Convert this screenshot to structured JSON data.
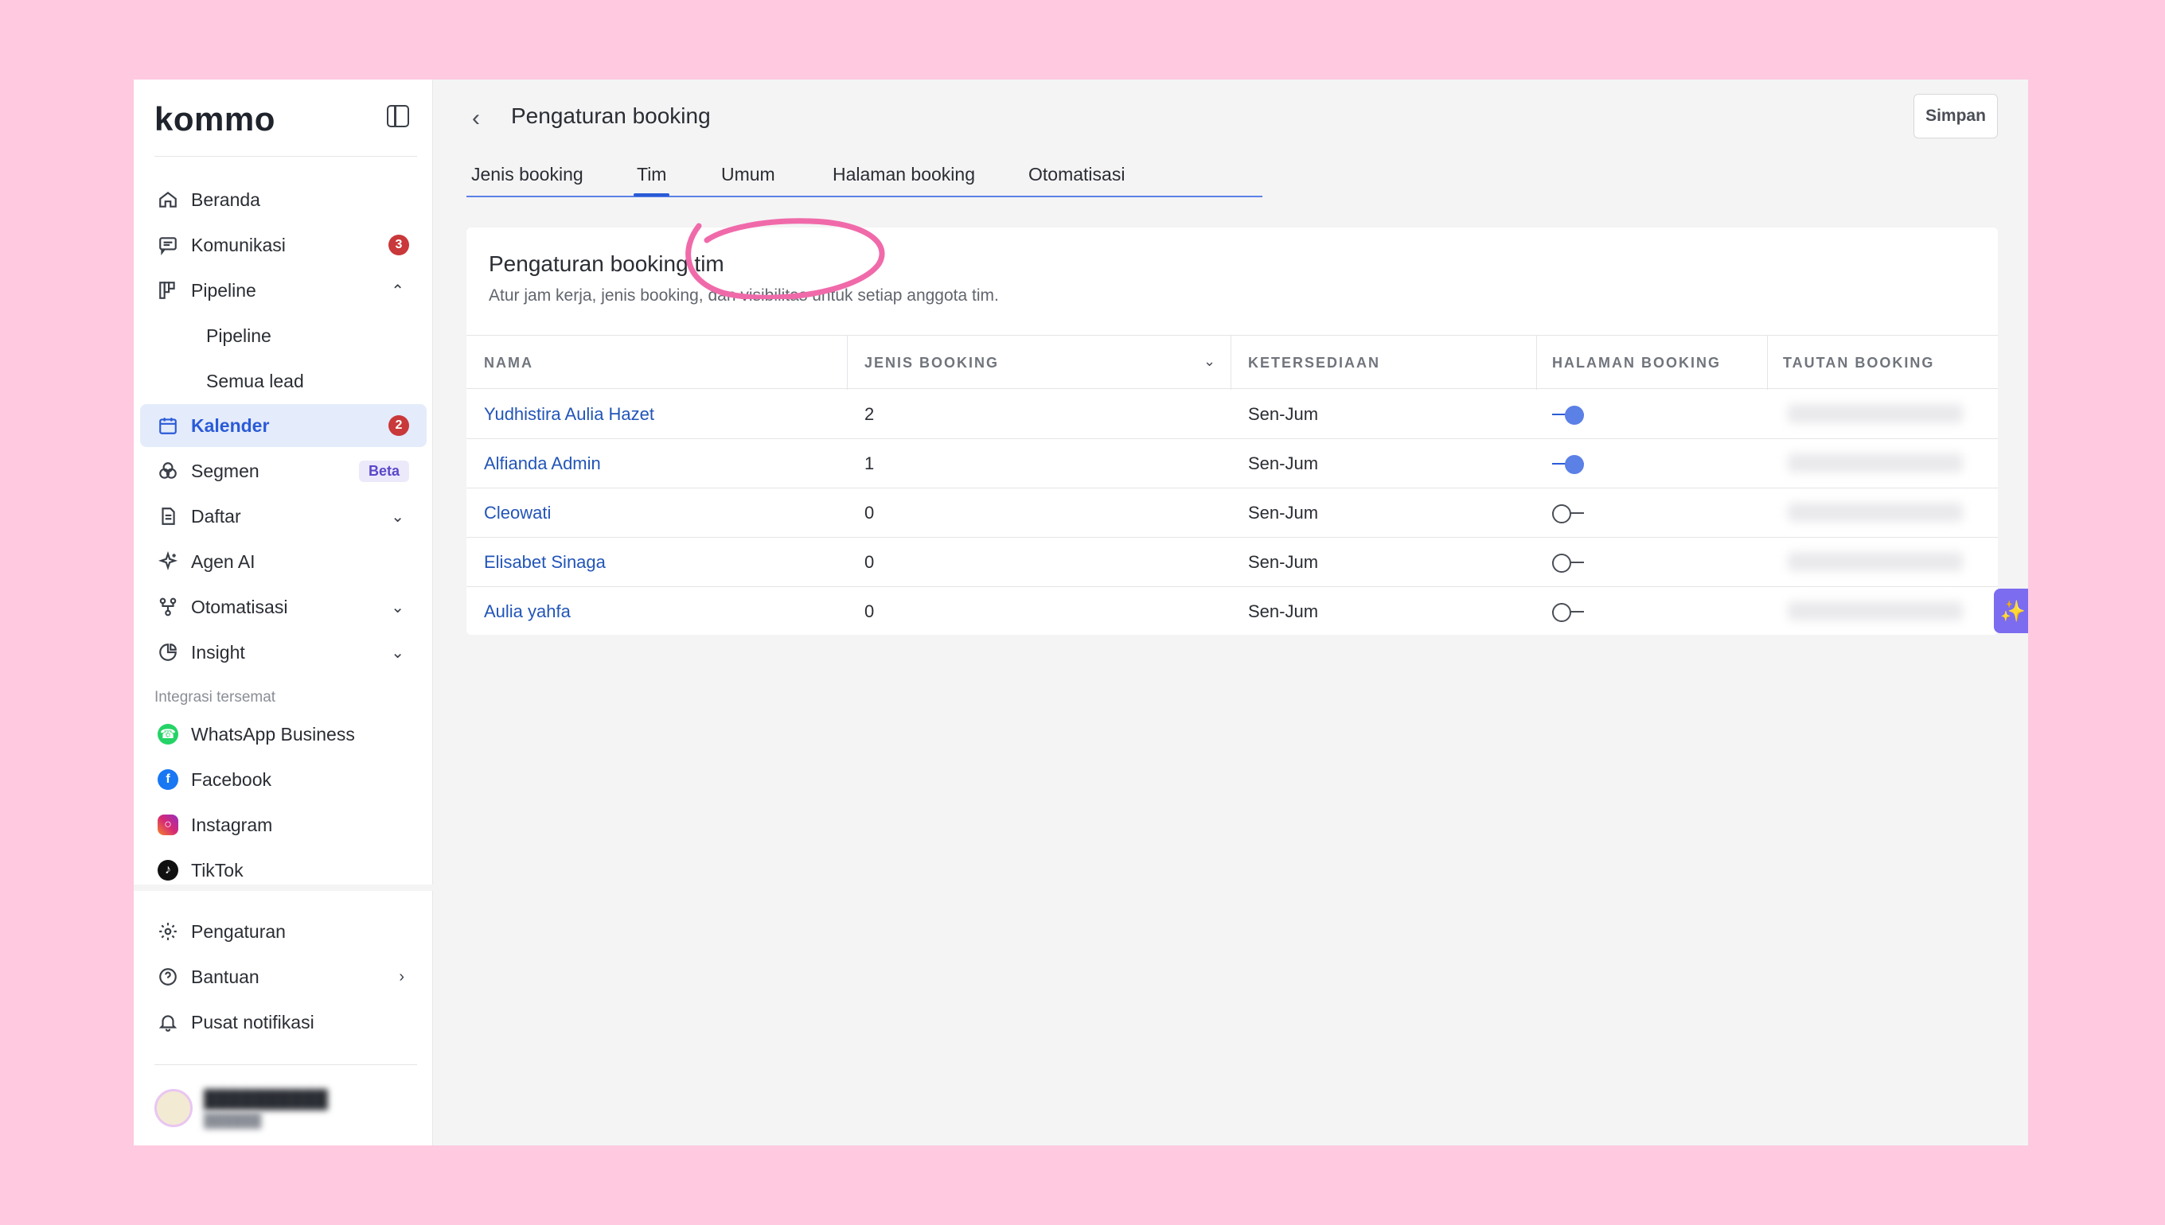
{
  "app": {
    "logo": "kommo"
  },
  "sidebar": {
    "items": [
      {
        "label": "Beranda",
        "icon": "home-icon"
      },
      {
        "label": "Komunikasi",
        "icon": "chat-icon",
        "badge": "3"
      },
      {
        "label": "Pipeline",
        "icon": "pipeline-icon",
        "expanded": true
      },
      {
        "label": "Pipeline"
      },
      {
        "label": "Semua lead"
      },
      {
        "label": "Kalender",
        "icon": "calendar-icon",
        "badge": "2",
        "active": true
      },
      {
        "label": "Segmen",
        "icon": "segment-icon",
        "tag": "Beta"
      },
      {
        "label": "Daftar",
        "icon": "list-icon"
      },
      {
        "label": "Agen AI",
        "icon": "sparkle-icon"
      },
      {
        "label": "Otomatisasi",
        "icon": "automation-icon"
      },
      {
        "label": "Insight",
        "icon": "chart-icon"
      }
    ],
    "integrations_label": "Integrasi tersemat",
    "integrations": [
      {
        "label": "WhatsApp Business",
        "color": "#25d366"
      },
      {
        "label": "Facebook",
        "color": "#1877f2"
      },
      {
        "label": "Instagram",
        "color": "#d62976"
      },
      {
        "label": "TikTok",
        "color": "#111111"
      }
    ],
    "bottom": [
      {
        "label": "Pengaturan",
        "icon": "gear-icon"
      },
      {
        "label": "Bantuan",
        "icon": "help-icon"
      },
      {
        "label": "Pusat notifikasi",
        "icon": "bell-icon"
      }
    ]
  },
  "header": {
    "title": "Pengaturan booking",
    "save_label": "Simpan"
  },
  "tabs": [
    "Jenis booking",
    "Tim",
    "Umum",
    "Halaman booking",
    "Otomatisasi"
  ],
  "active_tab": "Tim",
  "card": {
    "title": "Pengaturan booking tim",
    "subtitle": "Atur jam kerja, jenis booking, dan visibilitas untuk setiap anggota tim."
  },
  "table": {
    "columns": [
      "NAMA",
      "JENIS BOOKING",
      "KETERSEDIAAN",
      "HALAMAN BOOKING",
      "TAUTAN BOOKING"
    ],
    "rows": [
      {
        "name": "Yudhistira Aulia Hazet",
        "jenis": "2",
        "ketersediaan": "Sen-Jum",
        "halaman": true
      },
      {
        "name": "Alfianda Admin",
        "jenis": "1",
        "ketersediaan": "Sen-Jum",
        "halaman": true
      },
      {
        "name": "Cleowati",
        "jenis": "0",
        "ketersediaan": "Sen-Jum",
        "halaman": false
      },
      {
        "name": "Elisabet Sinaga",
        "jenis": "0",
        "ketersediaan": "Sen-Jum",
        "halaman": false
      },
      {
        "name": "Aulia yahfa",
        "jenis": "0",
        "ketersediaan": "Sen-Jum",
        "halaman": false
      }
    ]
  },
  "colors": {
    "accent": "#2a5bd7",
    "annotation": "#f06aaa",
    "background": "#ffc9e0"
  }
}
